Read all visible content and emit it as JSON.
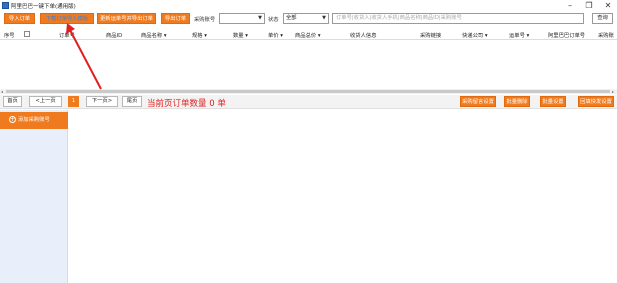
{
  "window": {
    "title": "阿里巴巴一键下单(通用版)",
    "controls": [
      "–",
      "❐",
      "✕"
    ]
  },
  "toolbar": {
    "import_orders": "导入订单",
    "download_template": "下载订单导入模板",
    "update_tracking": "更新运单号并导出订单",
    "export_orders": "导出订单",
    "purchase_account_label": "采购账号",
    "purchase_account_value": "",
    "status_label": "状态",
    "status_value": "全部",
    "search_placeholder": "订单号|收货人|收货人手机|商品名称|商品ID|采购账号",
    "query_button": "查询"
  },
  "table": {
    "columns": [
      "序号",
      "订单号",
      "商品ID",
      "商品名称",
      "规格",
      "数量",
      "单价",
      "商品总价",
      "收货人信息",
      "采购链接",
      "快递公司",
      "运单号",
      "阿里巴巴订单号",
      "采购账"
    ],
    "sort_arrow": "▾"
  },
  "pager": {
    "first": "首页",
    "prev": "<上一页",
    "current": "1",
    "next": "下一页>",
    "last": "尾页",
    "count_text": "当前页订单数量 0 单",
    "right_buttons": [
      "采购留言设置",
      "批量删除",
      "批量设置",
      "回填快发设置"
    ]
  },
  "sidebar": {
    "add_account": "添加采购账号"
  },
  "colors": {
    "accent_orange": "#f07b1f",
    "annotation_red": "#e02020",
    "link_blue": "#3a82e0",
    "sidebar_bg": "#e8effa"
  }
}
